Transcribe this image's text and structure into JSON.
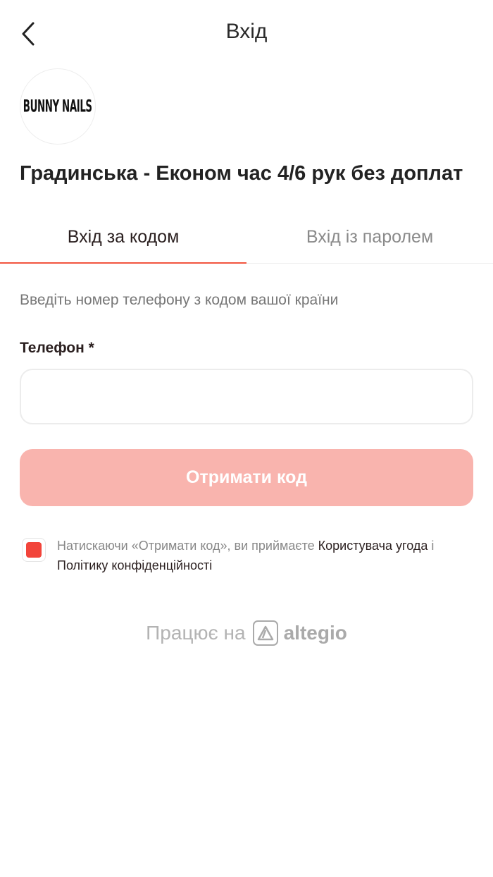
{
  "header": {
    "title": "Вхід",
    "back_icon": "chevron-left-icon"
  },
  "logo": {
    "text": "BUNNY NAILS"
  },
  "service": {
    "title": "Градинська - Економ час 4/6 рук без доплат"
  },
  "tabs": [
    {
      "label": "Вхід за кодом",
      "active": true
    },
    {
      "label": "Вхід із паролем",
      "active": false
    }
  ],
  "form": {
    "hint": "Введіть номер телефону з кодом вашої країни",
    "phone_label": "Телефон *",
    "phone_value": "",
    "submit_label": "Отримати код"
  },
  "consent": {
    "checked": true,
    "text_prefix": "Натискаючи «Отримати код», ви приймаєте ",
    "link_terms": "Користувача угода",
    "conjunction": " і ",
    "link_privacy": "Політику конфіденційності"
  },
  "footer": {
    "powered_by": "Працює на",
    "brand": "altegio"
  },
  "colors": {
    "accent": "#f2553f",
    "button_disabled": "#f9b4ae",
    "checkbox": "#f2443a"
  }
}
